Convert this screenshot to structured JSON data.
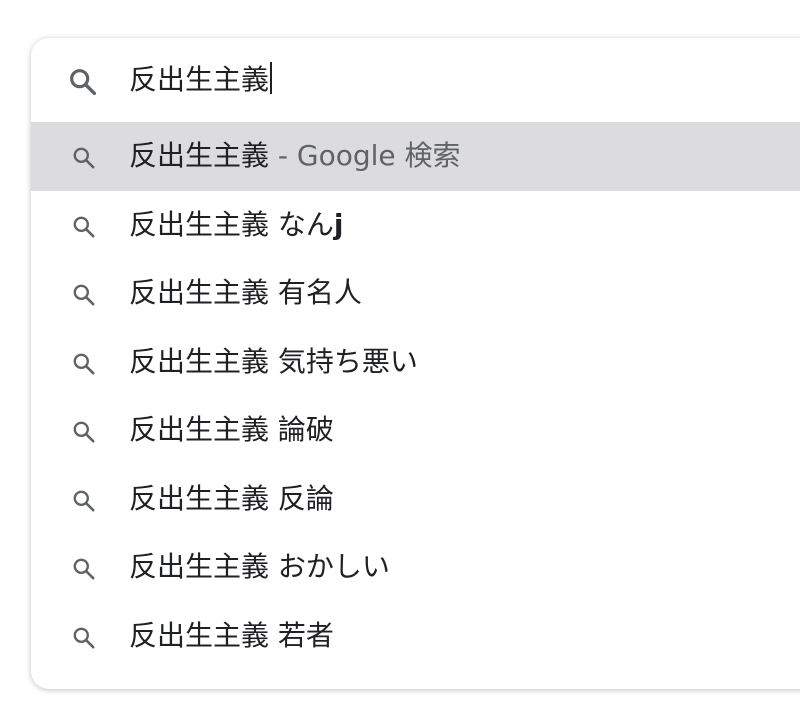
{
  "search": {
    "query": "反出生主義"
  },
  "suggestions": [
    {
      "prefix": "反出生主義",
      "suffix": " - Google 検索",
      "style": "dim",
      "selected": true
    },
    {
      "prefix": "反出生主義 なん",
      "suffix": "j",
      "style": "bold",
      "selected": false
    },
    {
      "prefix": "反出生主義 有名人",
      "suffix": "",
      "style": "",
      "selected": false
    },
    {
      "prefix": "反出生主義 気持ち悪い",
      "suffix": "",
      "style": "",
      "selected": false
    },
    {
      "prefix": "反出生主義 論破",
      "suffix": "",
      "style": "",
      "selected": false
    },
    {
      "prefix": "反出生主義 反論",
      "suffix": "",
      "style": "",
      "selected": false
    },
    {
      "prefix": "反出生主義 おかしい",
      "suffix": "",
      "style": "",
      "selected": false
    },
    {
      "prefix": "反出生主義 若者",
      "suffix": "",
      "style": "",
      "selected": false
    }
  ],
  "icons": {
    "input": "search-icon",
    "suggestion": "search-icon"
  },
  "colors": {
    "text": "#202124",
    "dim_text": "#5f6368",
    "icon": "#5f6368",
    "selected_row": "#dcdcde"
  }
}
